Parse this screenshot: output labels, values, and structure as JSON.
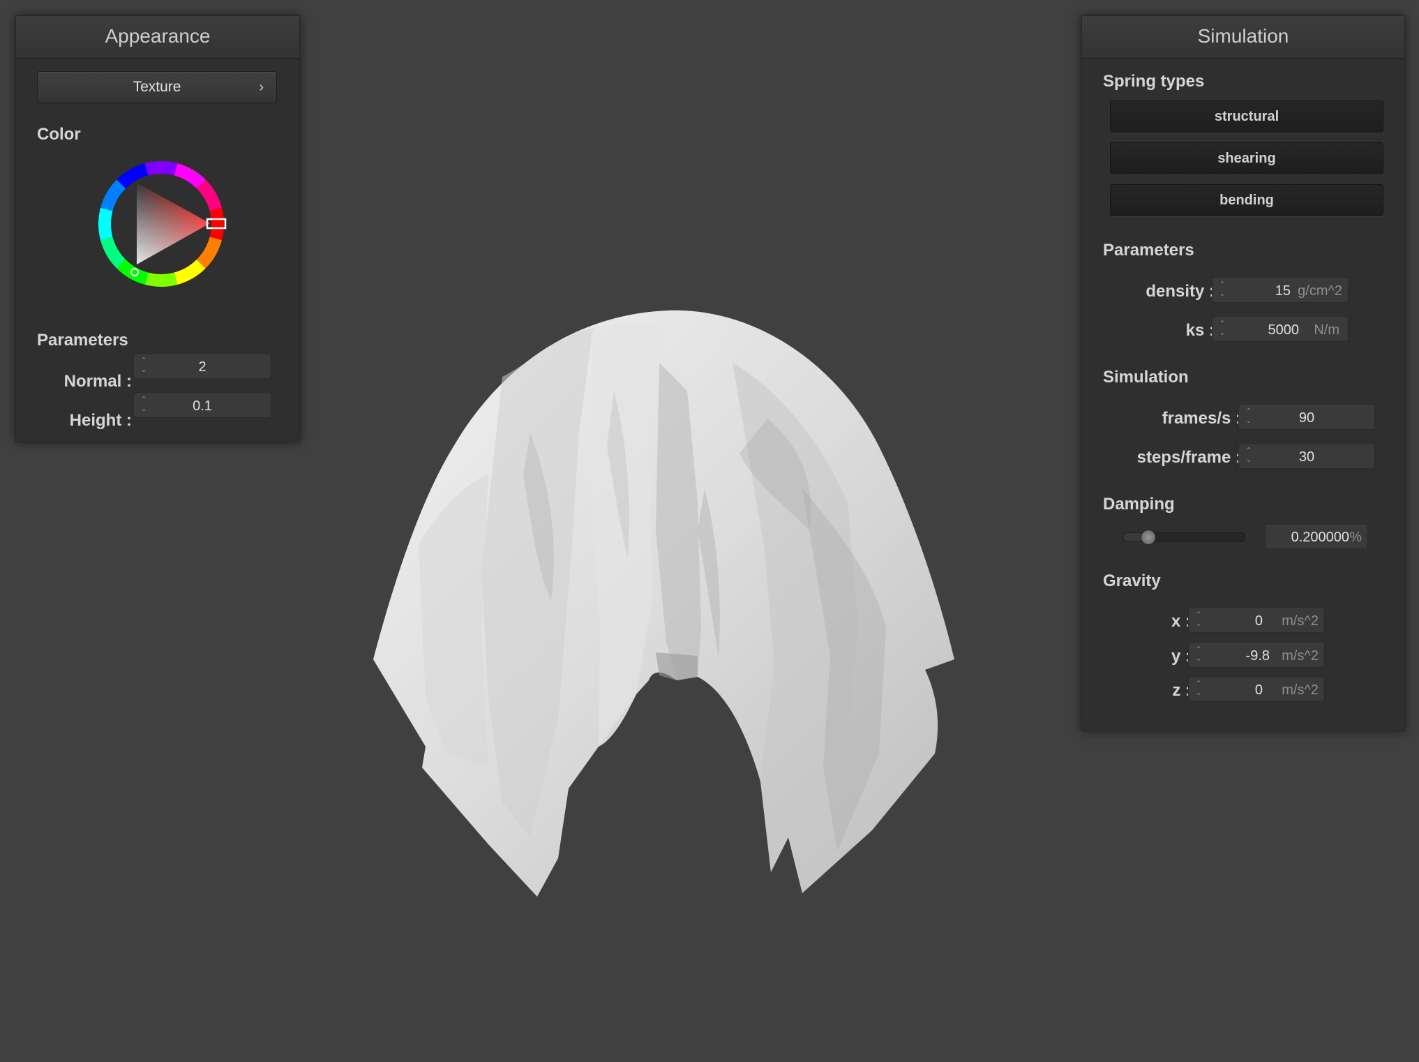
{
  "appearance": {
    "title": "Appearance",
    "texture_button": "Texture",
    "color_label": "Color",
    "parameters_label": "Parameters",
    "normal_label": "Normal :",
    "normal_value": "2",
    "height_label": "Height :",
    "height_value": "0.1",
    "selected_color": "#d40000"
  },
  "simulation": {
    "title": "Simulation",
    "spring_types_label": "Spring types",
    "spring_buttons": [
      "structural",
      "shearing",
      "bending"
    ],
    "parameters_label": "Parameters",
    "density_label": "density :",
    "density_value": "15",
    "density_unit": "g/cm^2",
    "ks_label": "ks :",
    "ks_value": "5000",
    "ks_unit": "N/m",
    "simulation_label": "Simulation",
    "fps_label": "frames/s :",
    "fps_value": "90",
    "steps_label": "steps/frame :",
    "steps_value": "30",
    "damping_label": "Damping",
    "damping_value": "0.200000",
    "damping_unit": "%",
    "damping_fraction": 0.2,
    "gravity_label": "Gravity",
    "gx_label": "x :",
    "gx_value": "0",
    "gy_label": "y :",
    "gy_value": "-9.8",
    "gz_label": "z :",
    "gz_value": "0",
    "gravity_unit": "m/s^2"
  }
}
